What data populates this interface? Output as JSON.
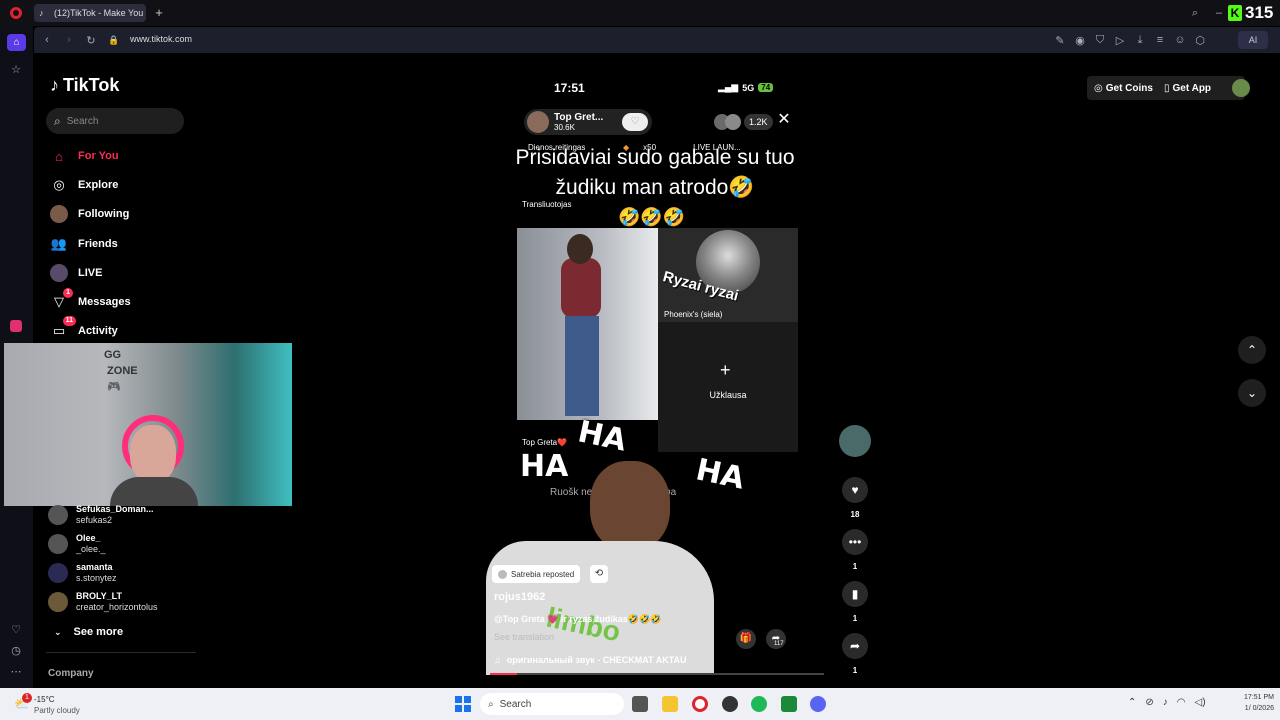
{
  "browser": {
    "tab_title": "(12)TikTok - Make You",
    "url": "www.tiktok.com",
    "new_tab": "+",
    "ai_label": "AI",
    "overlay_counter": "315"
  },
  "tiktok": {
    "logo": "TikTok",
    "search_placeholder": "Search",
    "nav": [
      {
        "label": "For You",
        "icon": "home-icon",
        "active": true
      },
      {
        "label": "Explore",
        "icon": "compass-icon"
      },
      {
        "label": "Following",
        "icon": "following-avatar-icon"
      },
      {
        "label": "Friends",
        "icon": "friends-icon"
      },
      {
        "label": "LIVE",
        "icon": "live-icon"
      },
      {
        "label": "Messages",
        "icon": "send-icon",
        "badge": "1"
      },
      {
        "label": "Activity",
        "icon": "inbox-icon",
        "badge": "11"
      }
    ],
    "following_accounts": [
      {
        "name": "Sefukas_Doman...",
        "username": "sefukas2"
      },
      {
        "name": "Olee_",
        "username": "_olee._"
      },
      {
        "name": "samanta",
        "username": "s.stonytez"
      },
      {
        "name": "BROLY_LT",
        "username": "creator_horizontolus"
      }
    ],
    "see_more": "See more",
    "company": "Company",
    "get_coins": "Get Coins",
    "get_app": "Get App"
  },
  "live": {
    "phone_time": "17:51",
    "network": "5G",
    "battery": "74",
    "host_name": "Top Gret...",
    "host_likes": "30.6K",
    "viewers": "1.2K",
    "ranking": "Dienos reitingas",
    "gift_multiplier": "x50",
    "live_launch": "LIVE LAUN...",
    "headline": "Prisidaviai sudo gabale su tuo žudiku man atrodo🤣",
    "headline_emojis": "🤣🤣🤣",
    "broadcaster_label": "Transliuotojas",
    "guest_overlay_text": "Ryzai ryzai",
    "guest_name": "Phoenix's (siela)",
    "request_label": "Užklausa",
    "chat_user": "Top Greta❤️",
    "chat_text": "Ruošk ne... dra gražu... mba",
    "meme_ha": [
      "HA",
      "HA",
      "HA"
    ],
    "repost_label": "Satrebia reposted",
    "author": "rojus1962",
    "caption": "@Top Greta 💗 ir ryzas žudikas🤣🤣🤣",
    "see_translation": "See translation",
    "sound": "оригинальный звук - CHECKMAT AKTAU",
    "share_count": "117"
  },
  "actions": {
    "likes": "18",
    "comments": "1",
    "saves": "1",
    "shares": "1"
  },
  "taskbar": {
    "weather_temp": "-15°C",
    "weather_desc": "Partly cloudy",
    "weather_badge": "1",
    "search": "Search",
    "time": "17:51 PM",
    "date": "1/ 0/2026"
  },
  "colors": {
    "accent": "#fe2c55",
    "background": "#000000",
    "taskbar": "#eef0f5"
  }
}
